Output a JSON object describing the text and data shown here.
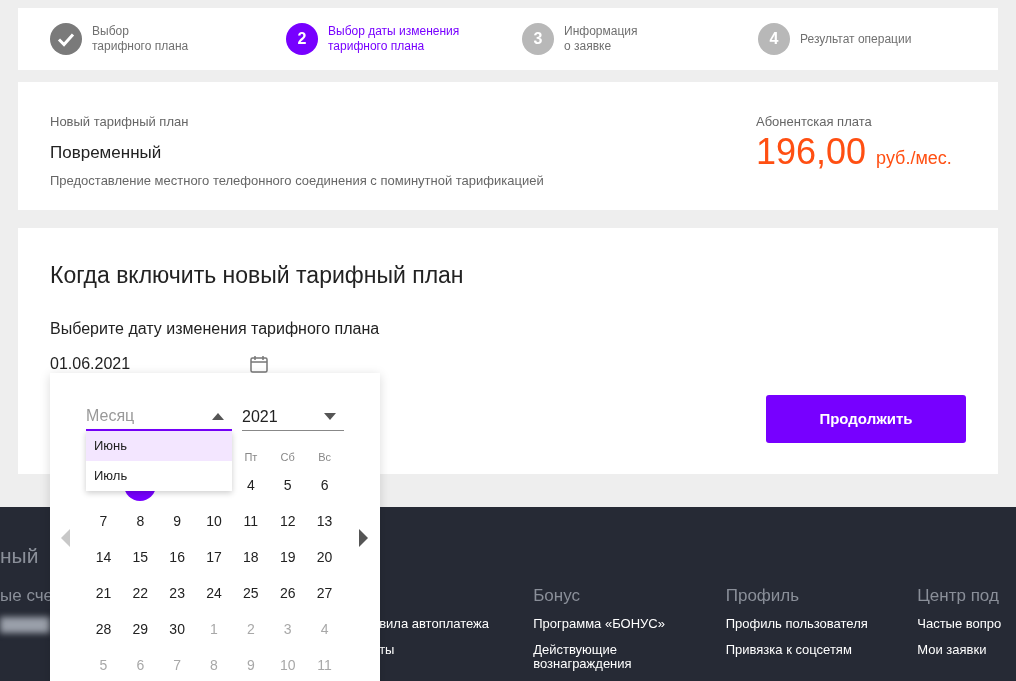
{
  "steps": [
    {
      "label": "Выбор\nтарифного плана",
      "kind": "done"
    },
    {
      "number": "2",
      "label": "Выбор даты изменения\nтарифного плана",
      "kind": "current"
    },
    {
      "number": "3",
      "label": "Информация\nо заявке",
      "kind": "pending"
    },
    {
      "number": "4",
      "label": "Результат операции",
      "kind": "pending"
    }
  ],
  "tariff": {
    "caption": "Новый тарифный план",
    "name": "Повременный",
    "description": "Предоставление местного телефонного соединения с поминутной тарификацией",
    "fee_label": "Абонентская плата",
    "fee": "196,00",
    "unit": "руб./мес."
  },
  "schedule": {
    "title": "Когда включить новый тарифный план",
    "date_label": "Выберите дату изменения тарифного плана",
    "date_value": "01.06.2021",
    "continue_button": "Продолжить"
  },
  "calendar": {
    "month_select": {
      "placeholder": "Месяц",
      "expanded": true
    },
    "year_select": {
      "value": "2021",
      "expanded": false
    },
    "month_options": [
      {
        "label": "Июнь",
        "selected": true
      },
      {
        "label": "Июль",
        "selected": false
      }
    ],
    "weekdays": [
      "Пт",
      "Сб",
      "Вс"
    ],
    "first_week": [
      {
        "selected": false
      },
      {
        "selected": true
      },
      {
        "selected": false
      },
      {
        "selected": false
      },
      {
        "label": "4",
        "muted": false
      },
      {
        "label": "5",
        "muted": false
      },
      {
        "label": "6",
        "muted": false
      }
    ],
    "weeks": [
      [
        {
          "label": "7",
          "muted": false
        },
        {
          "label": "8",
          "muted": false
        },
        {
          "label": "9",
          "muted": false
        },
        {
          "label": "10",
          "muted": false
        },
        {
          "label": "11",
          "muted": false
        },
        {
          "label": "12",
          "muted": false
        },
        {
          "label": "13",
          "muted": false
        }
      ],
      [
        {
          "label": "14",
          "muted": false
        },
        {
          "label": "15",
          "muted": false
        },
        {
          "label": "16",
          "muted": false
        },
        {
          "label": "17",
          "muted": false
        },
        {
          "label": "18",
          "muted": false
        },
        {
          "label": "19",
          "muted": false
        },
        {
          "label": "20",
          "muted": false
        }
      ],
      [
        {
          "label": "21",
          "muted": false
        },
        {
          "label": "22",
          "muted": false
        },
        {
          "label": "23",
          "muted": false
        },
        {
          "label": "24",
          "muted": false
        },
        {
          "label": "25",
          "muted": false
        },
        {
          "label": "26",
          "muted": false
        },
        {
          "label": "27",
          "muted": false
        }
      ],
      [
        {
          "label": "28",
          "muted": false
        },
        {
          "label": "29",
          "muted": false
        },
        {
          "label": "30",
          "muted": false
        },
        {
          "label": "1",
          "muted": true
        },
        {
          "label": "2",
          "muted": true
        },
        {
          "label": "3",
          "muted": true
        },
        {
          "label": "4",
          "muted": true
        }
      ],
      [
        {
          "label": "5",
          "muted": true
        },
        {
          "label": "6",
          "muted": true
        },
        {
          "label": "7",
          "muted": true
        },
        {
          "label": "8",
          "muted": true
        },
        {
          "label": "9",
          "muted": true
        },
        {
          "label": "10",
          "muted": true
        },
        {
          "label": "11",
          "muted": true
        }
      ]
    ],
    "prev_disabled": true
  },
  "footer": {
    "title": "ный",
    "columns": [
      {
        "heading": "ые сче",
        "masked": true
      },
      {
        "links": [
          "вила автоплатежа",
          "ты"
        ]
      },
      {
        "heading": "Бонус",
        "links": [
          "Программа «БОНУС»",
          "Действующие\nвознаграждения"
        ]
      },
      {
        "heading": "Профиль",
        "links": [
          "Профиль пользователя",
          "Привязка к соцсетям"
        ]
      },
      {
        "heading": "Центр под",
        "links": [
          "Частые вопро",
          "Мои заявки"
        ]
      }
    ]
  }
}
